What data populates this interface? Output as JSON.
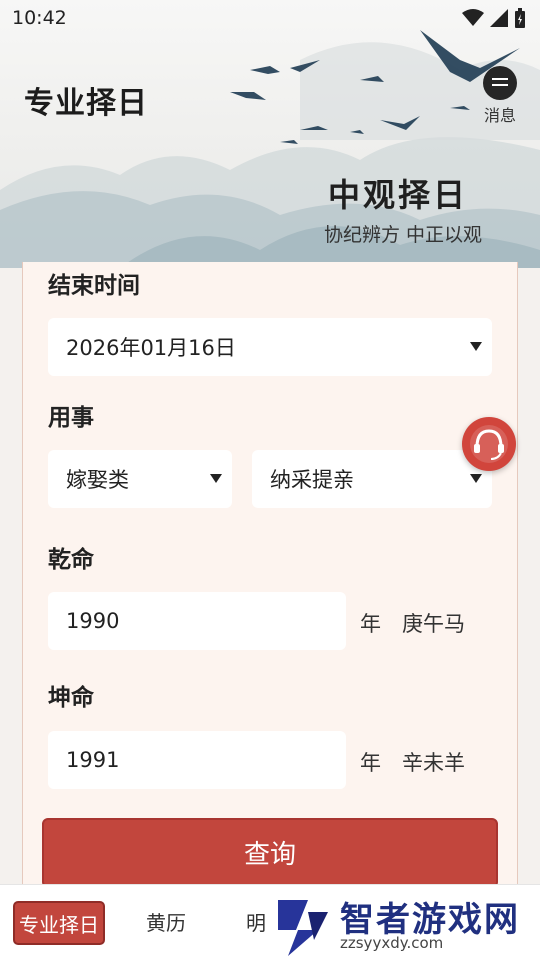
{
  "status_bar": {
    "time": "10:42"
  },
  "header": {
    "title": "专业择日",
    "message_label": "消息",
    "brand_title": "中观择日",
    "brand_subtitle": "协纪辨方 中正以观"
  },
  "form": {
    "end_time_label": "结束时间",
    "end_date_value": "2026年01月16日",
    "event_label": "用事",
    "event_category": "嫁娶类",
    "event_item": "纳采提亲",
    "qian_label": "乾命",
    "qian_year": "1990",
    "qian_year_suffix": "年",
    "qian_ganzhi": "庚午马",
    "kun_label": "坤命",
    "kun_year": "1991",
    "kun_year_suffix": "年",
    "kun_ganzhi": "辛未羊",
    "query_button": "查询"
  },
  "bottom_nav": {
    "items": [
      "专业择日",
      "黄历",
      "明"
    ]
  },
  "watermark": {
    "text": "智者游戏网",
    "url": "zzsyyxdy.com"
  },
  "colors": {
    "accent": "#c2463d",
    "card_bg": "#fdf4ef"
  }
}
